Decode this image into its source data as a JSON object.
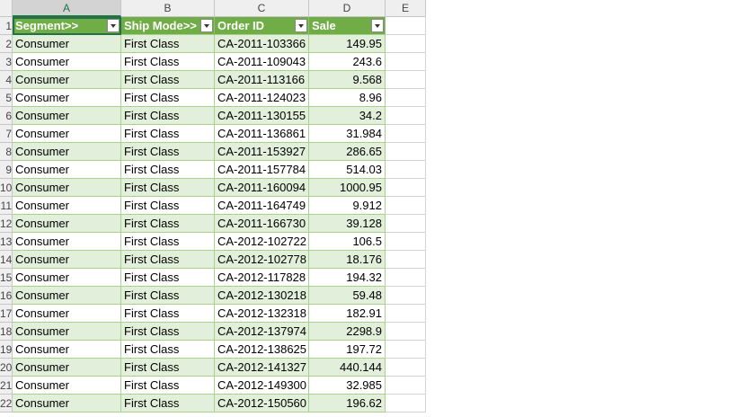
{
  "columns": [
    "A",
    "B",
    "C",
    "D",
    "E"
  ],
  "selected_column": "A",
  "header": {
    "segment": "Segment>>",
    "ship_mode": "Ship Mode>>",
    "order_id": "Order ID",
    "sale": "Sale"
  },
  "row_numbers": [
    "1",
    "2",
    "3",
    "4",
    "5",
    "6",
    "7",
    "8",
    "9",
    "10",
    "11",
    "12",
    "13",
    "14",
    "15",
    "16",
    "17",
    "18",
    "19",
    "20",
    "21",
    "22"
  ],
  "rows": [
    {
      "segment": "Consumer",
      "ship_mode": "First Class",
      "order_id": "CA-2011-103366",
      "sale": "149.95"
    },
    {
      "segment": "Consumer",
      "ship_mode": "First Class",
      "order_id": "CA-2011-109043",
      "sale": "243.6"
    },
    {
      "segment": "Consumer",
      "ship_mode": "First Class",
      "order_id": "CA-2011-113166",
      "sale": "9.568"
    },
    {
      "segment": "Consumer",
      "ship_mode": "First Class",
      "order_id": "CA-2011-124023",
      "sale": "8.96"
    },
    {
      "segment": "Consumer",
      "ship_mode": "First Class",
      "order_id": "CA-2011-130155",
      "sale": "34.2"
    },
    {
      "segment": "Consumer",
      "ship_mode": "First Class",
      "order_id": "CA-2011-136861",
      "sale": "31.984"
    },
    {
      "segment": "Consumer",
      "ship_mode": "First Class",
      "order_id": "CA-2011-153927",
      "sale": "286.65"
    },
    {
      "segment": "Consumer",
      "ship_mode": "First Class",
      "order_id": "CA-2011-157784",
      "sale": "514.03"
    },
    {
      "segment": "Consumer",
      "ship_mode": "First Class",
      "order_id": "CA-2011-160094",
      "sale": "1000.95"
    },
    {
      "segment": "Consumer",
      "ship_mode": "First Class",
      "order_id": "CA-2011-164749",
      "sale": "9.912"
    },
    {
      "segment": "Consumer",
      "ship_mode": "First Class",
      "order_id": "CA-2011-166730",
      "sale": "39.128"
    },
    {
      "segment": "Consumer",
      "ship_mode": "First Class",
      "order_id": "CA-2012-102722",
      "sale": "106.5"
    },
    {
      "segment": "Consumer",
      "ship_mode": "First Class",
      "order_id": "CA-2012-102778",
      "sale": "18.176"
    },
    {
      "segment": "Consumer",
      "ship_mode": "First Class",
      "order_id": "CA-2012-117828",
      "sale": "194.32"
    },
    {
      "segment": "Consumer",
      "ship_mode": "First Class",
      "order_id": "CA-2012-130218",
      "sale": "59.48"
    },
    {
      "segment": "Consumer",
      "ship_mode": "First Class",
      "order_id": "CA-2012-132318",
      "sale": "182.91"
    },
    {
      "segment": "Consumer",
      "ship_mode": "First Class",
      "order_id": "CA-2012-137974",
      "sale": "2298.9"
    },
    {
      "segment": "Consumer",
      "ship_mode": "First Class",
      "order_id": "CA-2012-138625",
      "sale": "197.72"
    },
    {
      "segment": "Consumer",
      "ship_mode": "First Class",
      "order_id": "CA-2012-141327",
      "sale": "440.144"
    },
    {
      "segment": "Consumer",
      "ship_mode": "First Class",
      "order_id": "CA-2012-149300",
      "sale": "32.985"
    },
    {
      "segment": "Consumer",
      "ship_mode": "First Class",
      "order_id": "CA-2012-150560",
      "sale": "196.62"
    }
  ],
  "colors": {
    "header_fill": "#70ad47",
    "band_fill": "#e2efda",
    "selection": "#217346"
  }
}
